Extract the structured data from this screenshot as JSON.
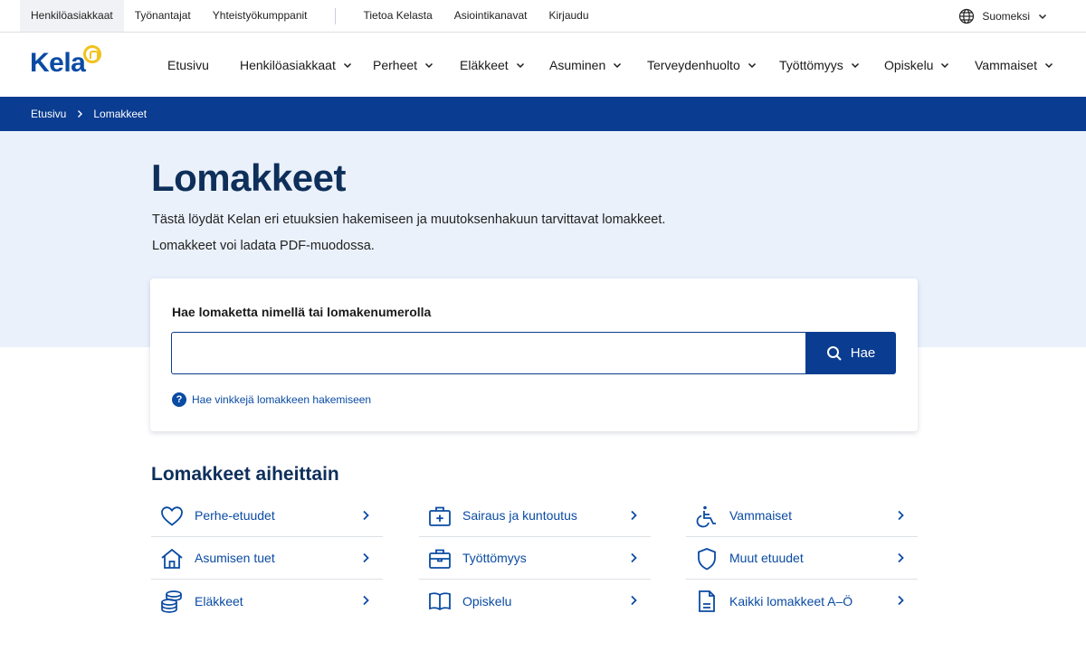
{
  "topbar": {
    "links": [
      "Henkilöasiakkaat",
      "Työnantajat",
      "Yhteistyökumppanit"
    ],
    "links_right": [
      "Tietoa Kelasta",
      "Asiointikanavat",
      "Kirjaudu"
    ],
    "language": "Suomeksi"
  },
  "logo": {
    "text": "Kela"
  },
  "nav": {
    "items": [
      {
        "label": "Etusivu",
        "has_menu": false
      },
      {
        "label": "Henkilöasiakkaat",
        "has_menu": true
      },
      {
        "label": "Perheet",
        "has_menu": true
      },
      {
        "label": "Eläkkeet",
        "has_menu": true
      },
      {
        "label": "Asuminen",
        "has_menu": true
      },
      {
        "label": "Terveydenhuolto",
        "has_menu": true
      },
      {
        "label": "Työttömyys",
        "has_menu": true
      },
      {
        "label": "Opiskelu",
        "has_menu": true
      },
      {
        "label": "Vammaiset",
        "has_menu": true
      }
    ]
  },
  "breadcrumb": {
    "home": "Etusivu",
    "current": "Lomakkeet"
  },
  "hero": {
    "title": "Lomakkeet",
    "intro1": "Tästä löydät Kelan eri etuuksien hakemiseen ja muutoksenhakuun tarvittavat lomakkeet.",
    "intro2": "Lomakkeet voi ladata PDF-muodossa."
  },
  "search": {
    "label": "Hae lomaketta nimellä tai lomakenumerolla",
    "value": "",
    "button": "Hae",
    "tips_link": "Hae vinkkejä lomakkeen hakemiseen"
  },
  "topics": {
    "title": "Lomakkeet aiheittain",
    "items": [
      {
        "label": "Perhe-etuudet",
        "icon": "heart-icon"
      },
      {
        "label": "Sairaus ja kuntoutus",
        "icon": "medical-case-icon"
      },
      {
        "label": "Vammaiset",
        "icon": "wheelchair-icon"
      },
      {
        "label": "Asumisen tuet",
        "icon": "house-icon"
      },
      {
        "label": "Työttömyys",
        "icon": "briefcase-icon"
      },
      {
        "label": "Muut etuudet",
        "icon": "shield-icon"
      },
      {
        "label": "Eläkkeet",
        "icon": "coins-icon"
      },
      {
        "label": "Opiskelu",
        "icon": "book-icon"
      },
      {
        "label": "Kaikki lomakkeet A–Ö",
        "icon": "document-icon"
      }
    ]
  },
  "colors": {
    "brand_blue": "#0a3d91",
    "link_blue": "#0a4ba3",
    "title_navy": "#0e2f5a",
    "hero_bg": "#eaf1fb",
    "logo_yellow": "#f1c21b"
  }
}
